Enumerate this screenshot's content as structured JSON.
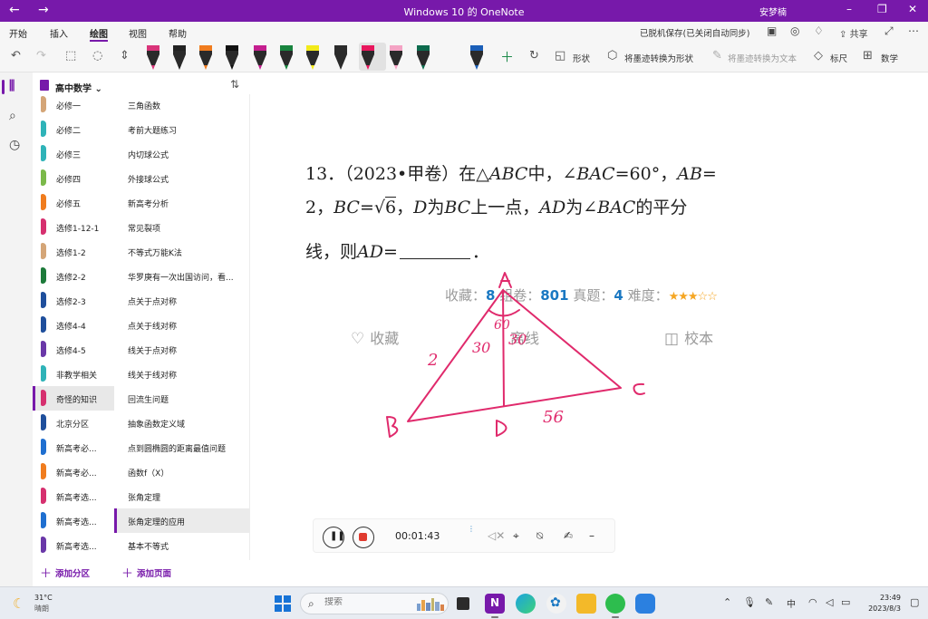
{
  "window": {
    "title": "Windows 10 的 OneNote",
    "user": "安梦楠",
    "back_icon": "←",
    "forward_icon": "→",
    "minimize_icon": "–",
    "restore_icon": "❐",
    "close_icon": "✕"
  },
  "menu": {
    "items": [
      "开始",
      "插入",
      "绘图",
      "视图",
      "帮助"
    ],
    "active": "绘图",
    "sync_status": "已脱机保存(已关闭自动同步)",
    "share_label": "共享"
  },
  "toolbar": {
    "pen_colors": [
      "#d9347a",
      "#222222",
      "#f07c1e",
      "#111111",
      "#c41e8f",
      "#18843e",
      "#f2ea1a",
      "#2b2b2b",
      "#e8175d",
      "#f4a3c4",
      "#0d6b4d",
      "#1b5fb8"
    ],
    "shapes_label": "形状",
    "ink_to_shape_label": "将墨迹转换为形状",
    "ink_to_text_label": "将墨迹转换为文本",
    "ruler_label": "标尺",
    "math_label": "数学"
  },
  "notebook": {
    "name": "高中数学",
    "add_section": "添加分区",
    "add_page": "添加页面"
  },
  "sections": [
    {
      "label": "必修一",
      "color": "#d4a577"
    },
    {
      "label": "必修二",
      "color": "#2fb3b8"
    },
    {
      "label": "必修三",
      "color": "#2fb3b8"
    },
    {
      "label": "必修四",
      "color": "#7bb94a"
    },
    {
      "label": "必修五",
      "color": "#f07c1e"
    },
    {
      "label": "选修1-12-1",
      "color": "#d6306f"
    },
    {
      "label": "选修1-2",
      "color": "#d4a577"
    },
    {
      "label": "选修2-2",
      "color": "#1d7a3a"
    },
    {
      "label": "选修2-3",
      "color": "#1f4f9c"
    },
    {
      "label": "选修4-4",
      "color": "#1f4f9c"
    },
    {
      "label": "选修4-5",
      "color": "#6a38a8"
    },
    {
      "label": "非教学相关",
      "color": "#2fb3b8"
    },
    {
      "label": "奇怪的知识",
      "color": "#d6306f"
    },
    {
      "label": "北京分区",
      "color": "#1f4f9c"
    },
    {
      "label": "新高考必...",
      "color": "#1f6fd0"
    },
    {
      "label": "新高考必...",
      "color": "#f07c1e"
    },
    {
      "label": "新高考选...",
      "color": "#d6306f"
    },
    {
      "label": "新高考选...",
      "color": "#1f6fd0"
    },
    {
      "label": "新高考选...",
      "color": "#6a38a8"
    }
  ],
  "pages": [
    "三角函数",
    "考前大题练习",
    "内切球公式",
    "外接球公式",
    "新高考分析",
    "常见裂项",
    "不等式万能K法",
    "华罗庚有一次出国访问，看...",
    "点关于点对称",
    "点关于线对称",
    "线关于点对称",
    "线关于线对称",
    "回流生问题",
    "抽象函数定义域",
    "点到圆椭圆的距离最值问题",
    "函数f（X）",
    "张角定理",
    "张角定理的应用",
    "基本不等式"
  ],
  "question": {
    "number": "13．",
    "source": "（2023•甲卷）在△",
    "tri": "ABC",
    "t1": "中，∠",
    "angle_name": "BAC",
    "t2": "=60°，",
    "ab": "AB",
    "t3": "=",
    "line2_a": "2，",
    "bc": "BC",
    "t4": "=",
    "sqrt_sign": "√",
    "sqrt_val": "6",
    "t5": "，",
    "d": "D",
    "t6": "为",
    "bc2": "BC",
    "t7": "上一点，",
    "ad": "AD",
    "t8": "为∠",
    "bac2": "BAC",
    "t9": "的平分",
    "line3_a": "线，则",
    "ad2": "AD",
    "t10": "=",
    "t11": "．"
  },
  "stats": {
    "fav_label": "收藏：",
    "fav_value": "8",
    "group_label": "组卷：",
    "group_value": "801",
    "real_label": "真题：",
    "real_value": "4",
    "difficulty_label": "难度：",
    "difficulty_stars": 3,
    "difficulty_max": 5
  },
  "actions": {
    "favorite": "收藏",
    "offline": "离线",
    "proofread": "校本"
  },
  "ink_labels": {
    "A": "A",
    "B": "B",
    "C": "C",
    "D": "D",
    "side_ab": "2",
    "angle_left": "30",
    "angle_right": "30",
    "angle_top": "60",
    "side_bc": "56"
  },
  "recorder": {
    "elapsed": "00:01:43"
  },
  "taskbar": {
    "temperature": "31°C",
    "weather": "晴朗",
    "search_placeholder": "搜索",
    "time": "23:49",
    "date": "2023/8/3",
    "input_method": "中"
  }
}
